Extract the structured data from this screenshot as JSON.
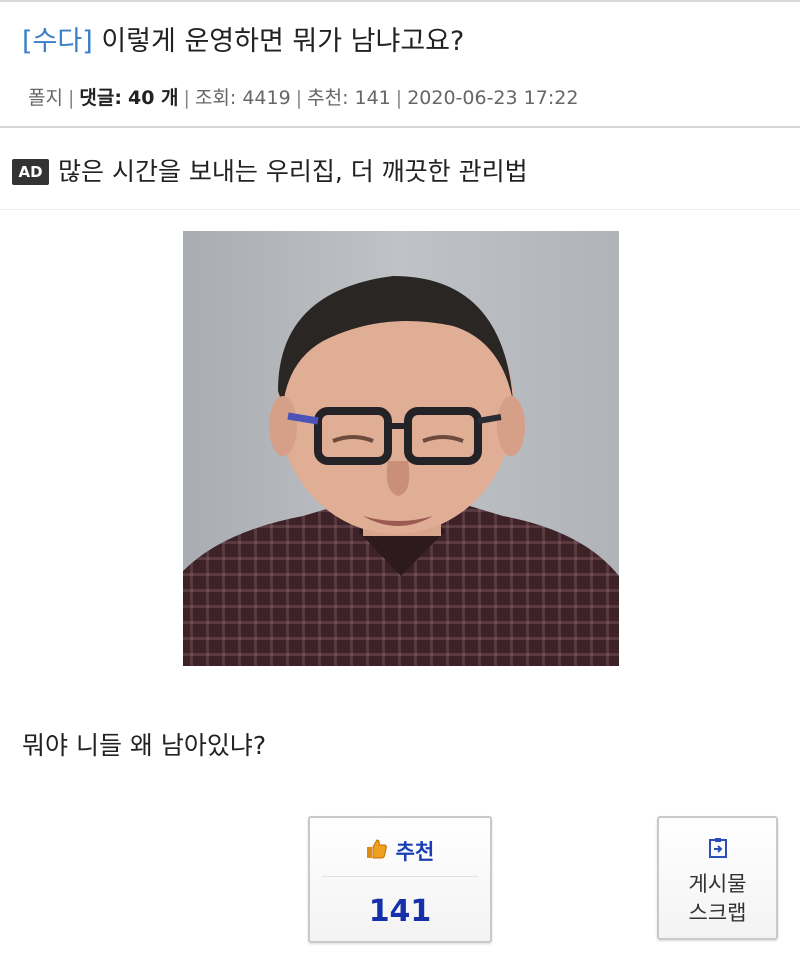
{
  "post": {
    "category": "[수다]",
    "title": "이렇게 운영하면 뭐가 남냐고요?",
    "meta": {
      "author": "폴지",
      "comments_label": "댓글:",
      "comments_count": "40 개",
      "views": "조회: 4419",
      "recommends": "추천: 141",
      "datetime": "2020-06-23 17:22"
    },
    "body": "뭐야 니들 왜 남아있냐?"
  },
  "ad": {
    "badge": "AD",
    "text": "많은 시간을 보내는 우리집, 더 깨끗한 관리법"
  },
  "actions": {
    "recommend_label": "추천",
    "recommend_count": "141",
    "scrap_label": "게시물\n스크랩"
  },
  "icons": {
    "thumbs_up": "thumbs-up-icon",
    "scrap": "scrap-icon"
  },
  "colors": {
    "category": "#3a7fc8",
    "recommend_text": "#1a3fb5",
    "recommend_count": "#1530a8",
    "thumb": "#f0a020"
  }
}
